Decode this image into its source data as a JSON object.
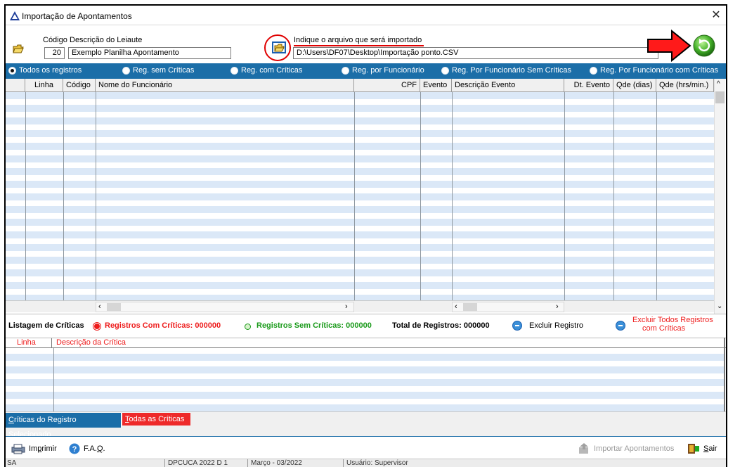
{
  "window": {
    "title": "Importação de Apontamentos",
    "close_label": "✕"
  },
  "top": {
    "codigo_label": "Código",
    "codigo_value": "20",
    "descricao_label": "Descrição do Leiaute",
    "descricao_value": "Exemplo Planilha Apontamento",
    "arquivo_label": "Indique o arquivo que será importado",
    "arquivo_value": "D:\\Users\\DF07\\Desktop\\Importação ponto.CSV"
  },
  "filters": [
    {
      "label": "Todos os registros",
      "selected": true
    },
    {
      "label": "Reg. sem Críticas",
      "selected": false
    },
    {
      "label": "Reg. com Críticas",
      "selected": false
    },
    {
      "label": "Reg. por Funcionário",
      "selected": false
    },
    {
      "label": "Reg. Por Funcionário Sem Críticas",
      "selected": false
    },
    {
      "label": "Reg. Por Funcionário com Críticas",
      "selected": false
    }
  ],
  "grid": {
    "columns": [
      "Linha",
      "Código",
      "Nome do Funcionário",
      "CPF",
      "Evento",
      "Descrição Evento",
      "Dt. Evento",
      "Qde (dias)",
      "Qde (hrs/min.)"
    ],
    "rows": []
  },
  "criticas": {
    "title": "Listagem de Críticas",
    "com_criticas": "Registros Com Críticas: 000000",
    "sem_criticas": "Registros Sem Críticas: 000000",
    "total": "Total de Registros: 000000",
    "excluir_registro": "Excluir Registro",
    "excluir_todos_line1": "Excluir Todos Registros",
    "excluir_todos_line2": "com Críticas",
    "columns": [
      "Linha",
      "Descrição da Crítica"
    ]
  },
  "tabs": {
    "selected_prefix": "C",
    "selected_rest": "ríticas do Registro Selecionado",
    "all_prefix": "T",
    "all_rest": "odas as Críticas"
  },
  "toolbar": {
    "imprimir_pre": "Im",
    "imprimir_u": "p",
    "imprimir_post": "rimir",
    "faq_pre": "F.A.",
    "faq_u": "Q",
    "faq_post": ".",
    "importar": "Importar Apontamentos",
    "sair_u": "S",
    "sair_post": "air"
  },
  "status": {
    "seg1": "SA",
    "seg2": "DPCUCA 2022 D 1",
    "seg3": "Março - 03/2022",
    "seg4": "Usuário: Supervisor"
  },
  "colors": {
    "accent": "#1b6ea8",
    "row_stripe": "#dbe8f7",
    "critica_red": "#ee1c1c",
    "ok_green": "#1a9a1a",
    "annotation_red": "#e00000"
  }
}
